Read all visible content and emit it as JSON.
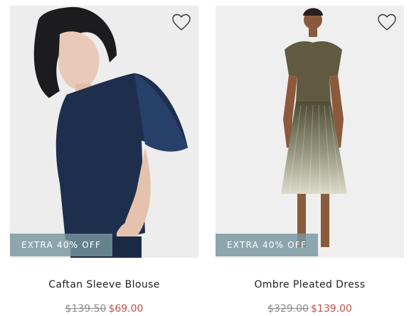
{
  "colors": {
    "promo_badge": "#7896a0",
    "sale_price": "#c0504d",
    "original_price": "#8a8a8a",
    "product_name": "#222222"
  },
  "products": [
    {
      "name": "Caftan Sleeve Blouse",
      "promo_badge": "EXTRA 40% OFF",
      "original_price": "$139.50",
      "sale_price": "$69.00",
      "wishlist_icon": "heart-outline-icon"
    },
    {
      "name": "Ombre Pleated Dress",
      "promo_badge": "EXTRA 40% OFF",
      "original_price": "$329.00",
      "sale_price": "$139.00",
      "wishlist_icon": "heart-outline-icon"
    }
  ]
}
